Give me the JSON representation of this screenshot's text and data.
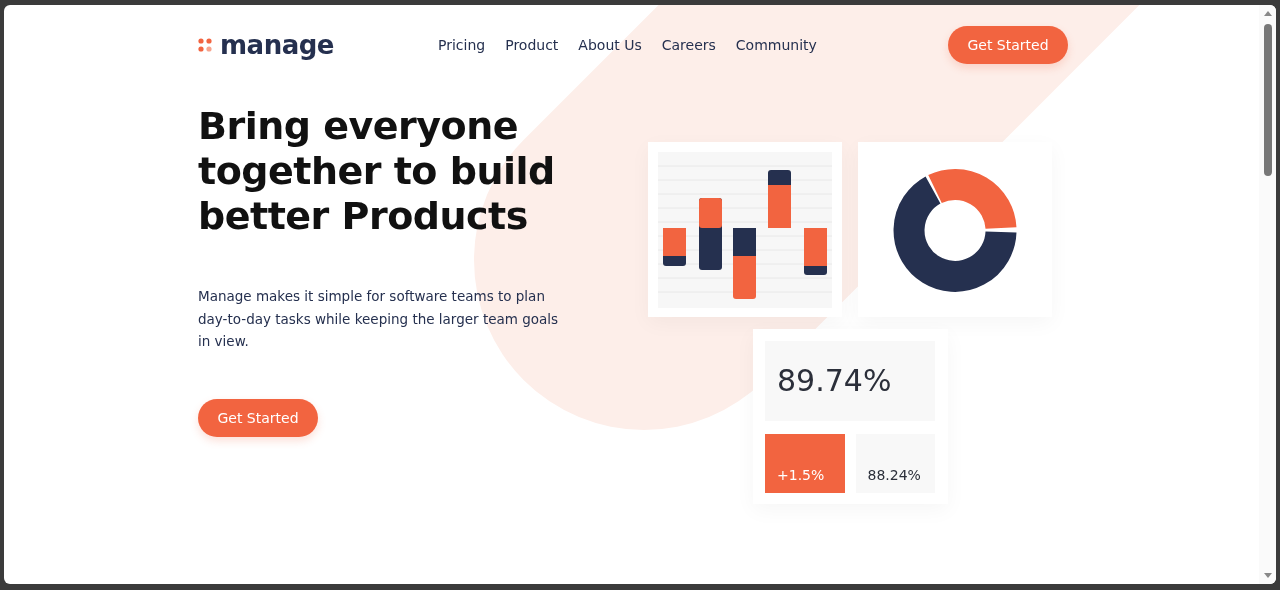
{
  "header": {
    "logo": "manage",
    "nav": [
      {
        "label": "Pricing"
      },
      {
        "label": "Product"
      },
      {
        "label": "About Us"
      },
      {
        "label": "Careers"
      },
      {
        "label": "Community"
      }
    ],
    "cta": "Get Started"
  },
  "hero": {
    "headline": "Bring everyone together to build better Products",
    "description": "Manage makes it simple for software teams to plan day-to-day tasks while keeping the larger team goals in view.",
    "cta": "Get Started"
  },
  "stats": {
    "main": "89.74%",
    "change": "+1.5%",
    "secondary": "88.24%"
  }
}
